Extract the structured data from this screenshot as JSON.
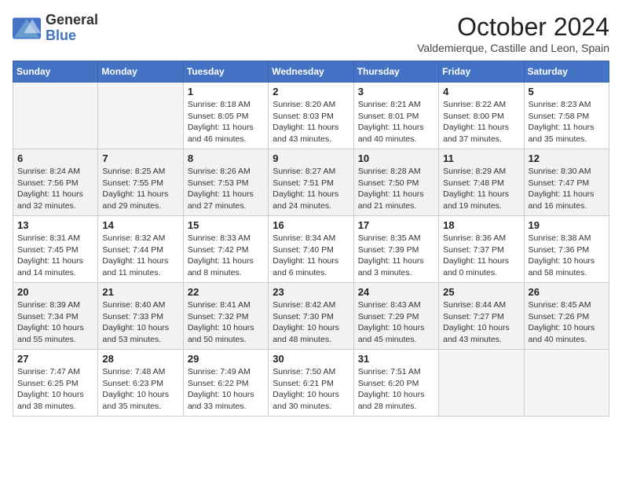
{
  "logo": {
    "general": "General",
    "blue": "Blue"
  },
  "title": {
    "month_year": "October 2024",
    "location": "Valdemierque, Castille and Leon, Spain"
  },
  "weekdays": [
    "Sunday",
    "Monday",
    "Tuesday",
    "Wednesday",
    "Thursday",
    "Friday",
    "Saturday"
  ],
  "weeks": [
    [
      {
        "day": "",
        "sunrise": "",
        "sunset": "",
        "daylight": ""
      },
      {
        "day": "",
        "sunrise": "",
        "sunset": "",
        "daylight": ""
      },
      {
        "day": "1",
        "sunrise": "Sunrise: 8:18 AM",
        "sunset": "Sunset: 8:05 PM",
        "daylight": "Daylight: 11 hours and 46 minutes."
      },
      {
        "day": "2",
        "sunrise": "Sunrise: 8:20 AM",
        "sunset": "Sunset: 8:03 PM",
        "daylight": "Daylight: 11 hours and 43 minutes."
      },
      {
        "day": "3",
        "sunrise": "Sunrise: 8:21 AM",
        "sunset": "Sunset: 8:01 PM",
        "daylight": "Daylight: 11 hours and 40 minutes."
      },
      {
        "day": "4",
        "sunrise": "Sunrise: 8:22 AM",
        "sunset": "Sunset: 8:00 PM",
        "daylight": "Daylight: 11 hours and 37 minutes."
      },
      {
        "day": "5",
        "sunrise": "Sunrise: 8:23 AM",
        "sunset": "Sunset: 7:58 PM",
        "daylight": "Daylight: 11 hours and 35 minutes."
      }
    ],
    [
      {
        "day": "6",
        "sunrise": "Sunrise: 8:24 AM",
        "sunset": "Sunset: 7:56 PM",
        "daylight": "Daylight: 11 hours and 32 minutes."
      },
      {
        "day": "7",
        "sunrise": "Sunrise: 8:25 AM",
        "sunset": "Sunset: 7:55 PM",
        "daylight": "Daylight: 11 hours and 29 minutes."
      },
      {
        "day": "8",
        "sunrise": "Sunrise: 8:26 AM",
        "sunset": "Sunset: 7:53 PM",
        "daylight": "Daylight: 11 hours and 27 minutes."
      },
      {
        "day": "9",
        "sunrise": "Sunrise: 8:27 AM",
        "sunset": "Sunset: 7:51 PM",
        "daylight": "Daylight: 11 hours and 24 minutes."
      },
      {
        "day": "10",
        "sunrise": "Sunrise: 8:28 AM",
        "sunset": "Sunset: 7:50 PM",
        "daylight": "Daylight: 11 hours and 21 minutes."
      },
      {
        "day": "11",
        "sunrise": "Sunrise: 8:29 AM",
        "sunset": "Sunset: 7:48 PM",
        "daylight": "Daylight: 11 hours and 19 minutes."
      },
      {
        "day": "12",
        "sunrise": "Sunrise: 8:30 AM",
        "sunset": "Sunset: 7:47 PM",
        "daylight": "Daylight: 11 hours and 16 minutes."
      }
    ],
    [
      {
        "day": "13",
        "sunrise": "Sunrise: 8:31 AM",
        "sunset": "Sunset: 7:45 PM",
        "daylight": "Daylight: 11 hours and 14 minutes."
      },
      {
        "day": "14",
        "sunrise": "Sunrise: 8:32 AM",
        "sunset": "Sunset: 7:44 PM",
        "daylight": "Daylight: 11 hours and 11 minutes."
      },
      {
        "day": "15",
        "sunrise": "Sunrise: 8:33 AM",
        "sunset": "Sunset: 7:42 PM",
        "daylight": "Daylight: 11 hours and 8 minutes."
      },
      {
        "day": "16",
        "sunrise": "Sunrise: 8:34 AM",
        "sunset": "Sunset: 7:40 PM",
        "daylight": "Daylight: 11 hours and 6 minutes."
      },
      {
        "day": "17",
        "sunrise": "Sunrise: 8:35 AM",
        "sunset": "Sunset: 7:39 PM",
        "daylight": "Daylight: 11 hours and 3 minutes."
      },
      {
        "day": "18",
        "sunrise": "Sunrise: 8:36 AM",
        "sunset": "Sunset: 7:37 PM",
        "daylight": "Daylight: 11 hours and 0 minutes."
      },
      {
        "day": "19",
        "sunrise": "Sunrise: 8:38 AM",
        "sunset": "Sunset: 7:36 PM",
        "daylight": "Daylight: 10 hours and 58 minutes."
      }
    ],
    [
      {
        "day": "20",
        "sunrise": "Sunrise: 8:39 AM",
        "sunset": "Sunset: 7:34 PM",
        "daylight": "Daylight: 10 hours and 55 minutes."
      },
      {
        "day": "21",
        "sunrise": "Sunrise: 8:40 AM",
        "sunset": "Sunset: 7:33 PM",
        "daylight": "Daylight: 10 hours and 53 minutes."
      },
      {
        "day": "22",
        "sunrise": "Sunrise: 8:41 AM",
        "sunset": "Sunset: 7:32 PM",
        "daylight": "Daylight: 10 hours and 50 minutes."
      },
      {
        "day": "23",
        "sunrise": "Sunrise: 8:42 AM",
        "sunset": "Sunset: 7:30 PM",
        "daylight": "Daylight: 10 hours and 48 minutes."
      },
      {
        "day": "24",
        "sunrise": "Sunrise: 8:43 AM",
        "sunset": "Sunset: 7:29 PM",
        "daylight": "Daylight: 10 hours and 45 minutes."
      },
      {
        "day": "25",
        "sunrise": "Sunrise: 8:44 AM",
        "sunset": "Sunset: 7:27 PM",
        "daylight": "Daylight: 10 hours and 43 minutes."
      },
      {
        "day": "26",
        "sunrise": "Sunrise: 8:45 AM",
        "sunset": "Sunset: 7:26 PM",
        "daylight": "Daylight: 10 hours and 40 minutes."
      }
    ],
    [
      {
        "day": "27",
        "sunrise": "Sunrise: 7:47 AM",
        "sunset": "Sunset: 6:25 PM",
        "daylight": "Daylight: 10 hours and 38 minutes."
      },
      {
        "day": "28",
        "sunrise": "Sunrise: 7:48 AM",
        "sunset": "Sunset: 6:23 PM",
        "daylight": "Daylight: 10 hours and 35 minutes."
      },
      {
        "day": "29",
        "sunrise": "Sunrise: 7:49 AM",
        "sunset": "Sunset: 6:22 PM",
        "daylight": "Daylight: 10 hours and 33 minutes."
      },
      {
        "day": "30",
        "sunrise": "Sunrise: 7:50 AM",
        "sunset": "Sunset: 6:21 PM",
        "daylight": "Daylight: 10 hours and 30 minutes."
      },
      {
        "day": "31",
        "sunrise": "Sunrise: 7:51 AM",
        "sunset": "Sunset: 6:20 PM",
        "daylight": "Daylight: 10 hours and 28 minutes."
      },
      {
        "day": "",
        "sunrise": "",
        "sunset": "",
        "daylight": ""
      },
      {
        "day": "",
        "sunrise": "",
        "sunset": "",
        "daylight": ""
      }
    ]
  ]
}
